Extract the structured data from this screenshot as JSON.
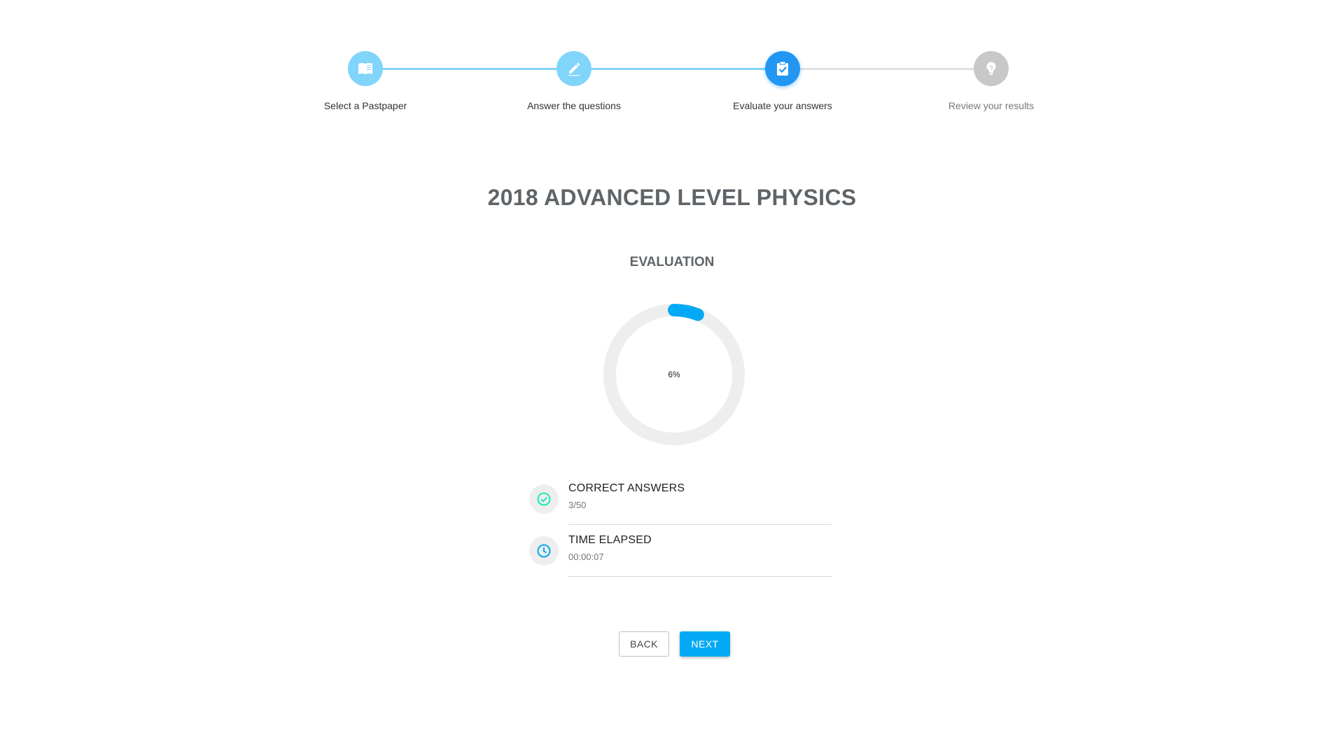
{
  "stepper": {
    "steps": [
      {
        "label": "Select a Pastpaper",
        "icon": "book-icon",
        "state": "completed"
      },
      {
        "label": "Answer the questions",
        "icon": "pencil-icon",
        "state": "completed"
      },
      {
        "label": "Evaluate your answers",
        "icon": "clipboard-check-icon",
        "state": "active"
      },
      {
        "label": "Review your results",
        "icon": "lightbulb-icon",
        "state": "inactive"
      }
    ],
    "colors": {
      "completed": "#81d4fa",
      "active": "#2196f3",
      "inactive": "#c8c8c8",
      "line_done": "#81d4fa",
      "line_todo": "#e0e0e0"
    }
  },
  "page": {
    "title": "2018 ADVANCED LEVEL PHYSICS",
    "section_title": "EVALUATION"
  },
  "progress": {
    "label": "6%",
    "value_fraction": 0.06,
    "color": "#03a9f4",
    "track_color": "#eeeeee"
  },
  "stats": [
    {
      "title": "CORRECT ANSWERS",
      "value": "3/50",
      "icon": "check-circle-icon",
      "icon_color": "#1de9b6"
    },
    {
      "title": "TIME ELAPSED",
      "value": "00:00:07",
      "icon": "clock-icon",
      "icon_color": "#03a9f4"
    }
  ],
  "buttons": {
    "back": "BACK",
    "next": "NEXT"
  }
}
